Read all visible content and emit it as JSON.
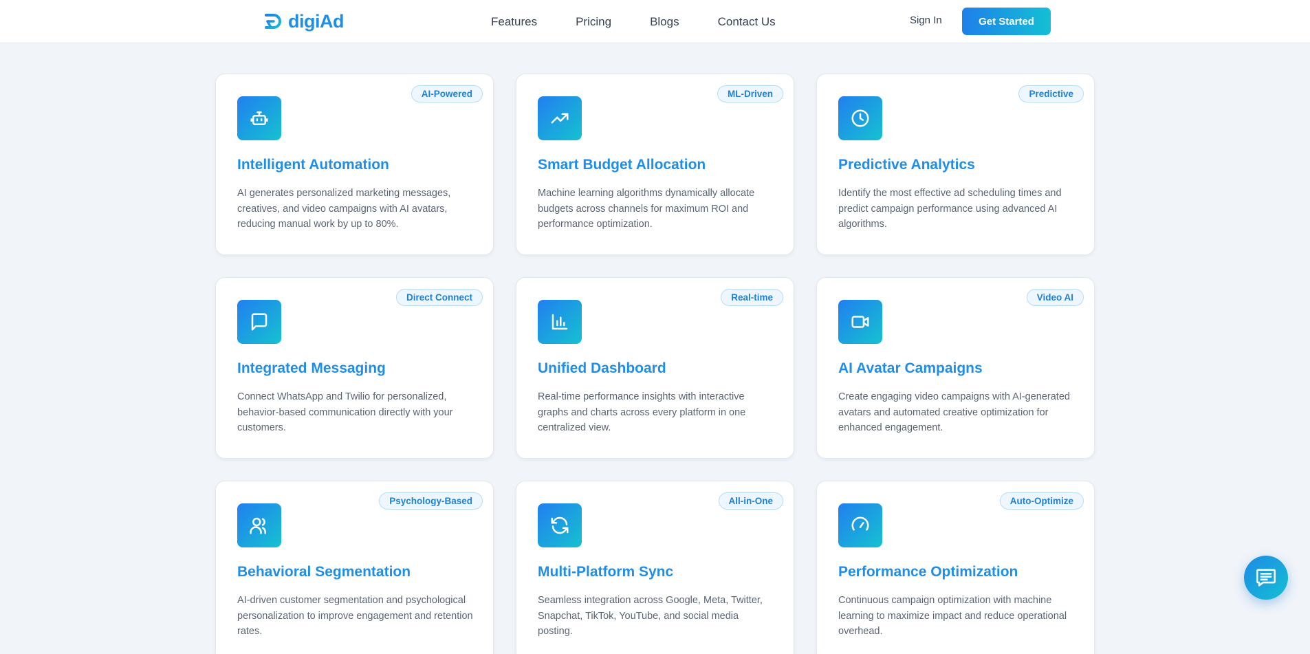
{
  "brand": {
    "name": "digiAd",
    "logo_icon": "digiad-logo-icon"
  },
  "nav": {
    "links": [
      "Features",
      "Pricing",
      "Blogs",
      "Contact Us"
    ],
    "sign_in": "Sign In",
    "cta": "Get Started"
  },
  "colors": {
    "accent": "#1f8ee8",
    "gradient_start": "#217ff0",
    "gradient_end": "#15c2d0",
    "page_bg": "#f1f4f9"
  },
  "cards": [
    {
      "icon": "robot-icon",
      "badge": "AI-Powered",
      "title": "Intelligent Automation",
      "description": "AI generates personalized marketing messages, creatives, and video campaigns with AI avatars, reducing manual work by up to 80%."
    },
    {
      "icon": "trending-up-icon",
      "badge": "ML-Driven",
      "title": "Smart Budget Allocation",
      "description": "Machine learning algorithms dynamically allocate budgets across channels for maximum ROI and performance optimization."
    },
    {
      "icon": "clock-icon",
      "badge": "Predictive",
      "title": "Predictive Analytics",
      "description": "Identify the most effective ad scheduling times and predict campaign performance using advanced AI algorithms."
    },
    {
      "icon": "message-square-icon",
      "badge": "Direct Connect",
      "title": "Integrated Messaging",
      "description": "Connect WhatsApp and Twilio for personalized, behavior-based communication directly with your customers."
    },
    {
      "icon": "bar-chart-icon",
      "badge": "Real-time",
      "title": "Unified Dashboard",
      "description": "Real-time performance insights with interactive graphs and charts across every platform in one centralized view."
    },
    {
      "icon": "video-icon",
      "badge": "Video AI",
      "title": "AI Avatar Campaigns",
      "description": "Create engaging video campaigns with AI-generated avatars and automated creative optimization for enhanced engagement."
    },
    {
      "icon": "users-icon",
      "badge": "Psychology-Based",
      "title": "Behavioral Segmentation",
      "description": "AI-driven customer segmentation and psychological personalization to improve engagement and retention rates."
    },
    {
      "icon": "refresh-icon",
      "badge": "All-in-One",
      "title": "Multi-Platform Sync",
      "description": "Seamless integration across Google, Meta, Twitter, Snapchat, TikTok, YouTube, and social media posting."
    },
    {
      "icon": "gauge-icon",
      "badge": "Auto-Optimize",
      "title": "Performance Optimization",
      "description": "Continuous campaign optimization with machine learning to maximize impact and reduce operational overhead."
    }
  ],
  "chat": {
    "icon": "chat-icon"
  }
}
